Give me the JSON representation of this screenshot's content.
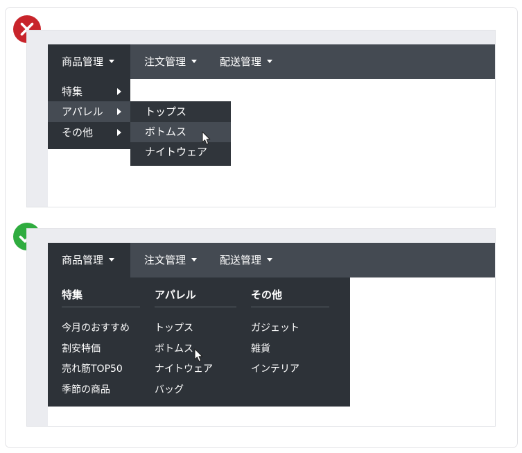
{
  "bad_example": {
    "nav": {
      "products": "商品管理",
      "orders": "注文管理",
      "shipping": "配送管理"
    },
    "menu": [
      "特集",
      "アパレル",
      "その他"
    ],
    "submenu": [
      "トップス",
      "ボトムス",
      "ナイトウェア"
    ],
    "colors": {
      "badge": "#c8242b"
    }
  },
  "good_example": {
    "nav": {
      "products": "商品管理",
      "orders": "注文管理",
      "shipping": "配送管理"
    },
    "columns": [
      {
        "heading": "特集",
        "items": [
          "今月のおすすめ",
          "割安特価",
          "売れ筋TOP50",
          "季節の商品"
        ]
      },
      {
        "heading": "アパレル",
        "items": [
          "トップス",
          "ボトムス",
          "ナイトウェア",
          "バッグ"
        ]
      },
      {
        "heading": "その他",
        "items": [
          "ガジェット",
          "雑貨",
          "インテリア"
        ]
      }
    ],
    "colors": {
      "badge": "#2fac3f"
    }
  }
}
